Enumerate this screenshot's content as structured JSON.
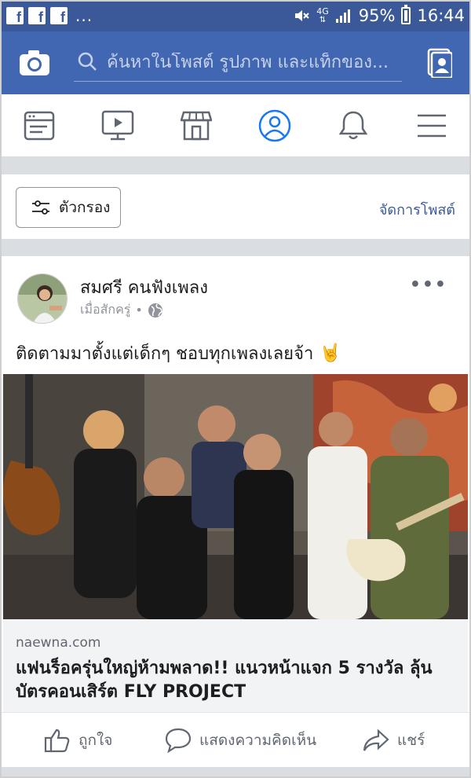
{
  "status_bar": {
    "notification_dots": "...",
    "network": "4G",
    "battery_percent": "95%",
    "time": "16:44",
    "fb_notification_count": 3
  },
  "search": {
    "placeholder": "ค้นหาในโพสต์ รูปภาพ และแท็กของ...",
    "icon": "search-icon"
  },
  "tabs": [
    {
      "name": "news-feed",
      "icon": "news-feed-icon"
    },
    {
      "name": "watch",
      "icon": "watch-video-icon"
    },
    {
      "name": "marketplace",
      "icon": "marketplace-store-icon"
    },
    {
      "name": "profile",
      "icon": "profile-icon",
      "active": true
    },
    {
      "name": "notifications",
      "icon": "bell-icon"
    },
    {
      "name": "menu",
      "icon": "hamburger-menu-icon"
    }
  ],
  "filter_bar": {
    "filter_label": "ตัวกรอง",
    "manage_label": "จัดการโพสต์"
  },
  "post": {
    "author": "สมศรี คนฟังเพลง",
    "time": "เมื่อสักครู่",
    "separator": "•",
    "privacy_icon": "globe-icon",
    "text": "ติดตามมาตั้งแต่เด็กๆ ชอบทุกเพลงเลยจ้า",
    "emoji": "🤘",
    "link": {
      "domain": "naewna.com",
      "title": "แฟนร็อครุ่นใหญ่ห้ามพลาด!! แนวหน้าแจก 5 รางวัล ลุ้นบัตรคอนเสิร์ต FLY PROJECT"
    },
    "actions": {
      "like": "ถูกใจ",
      "comment": "แสดงความคิดเห็น",
      "share": "แชร์"
    }
  },
  "colors": {
    "brand_dark": "#3b5998",
    "brand": "#4267b2",
    "link": "#385898",
    "active_tab": "#1877f2"
  }
}
